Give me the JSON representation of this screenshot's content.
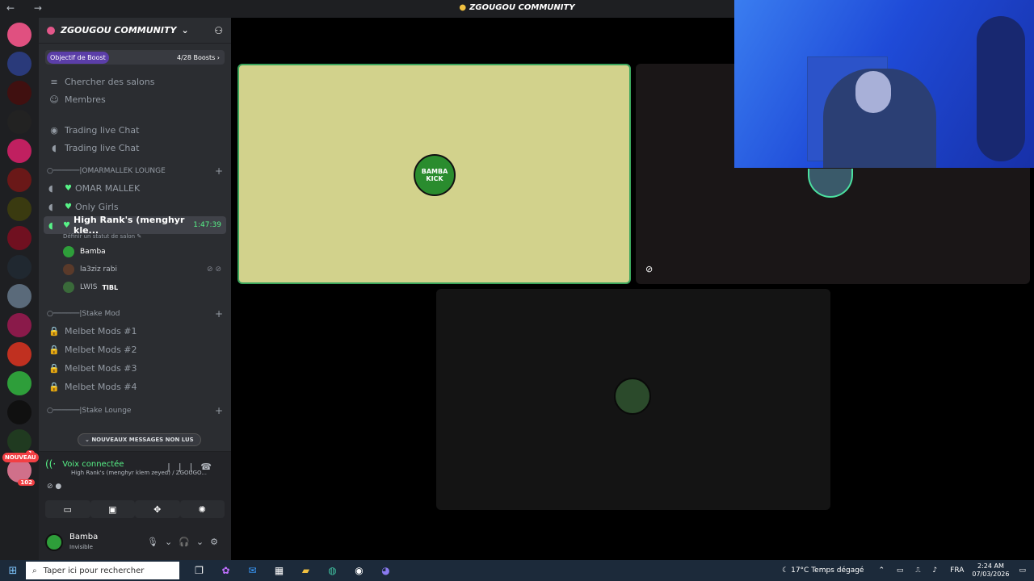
{
  "window": {
    "title": "ZGOUGOU COMMUNITY",
    "nav": "← →"
  },
  "server": {
    "name": "ZGOUGOU COMMUNITY",
    "boost_goal": "Objectif de Boost",
    "boost_count": "4/28 Boosts"
  },
  "menu": [
    {
      "label": "Chercher des salons",
      "icon": "≡"
    },
    {
      "label": "Membres",
      "icon": "☺"
    }
  ],
  "channels_top": [
    {
      "label": "Trading live Chat",
      "icon": "◉"
    },
    {
      "label": "Trading live Chat",
      "icon": "◖"
    }
  ],
  "categories": {
    "lounge": "○──────|OMARMALLEK LOUNGE",
    "stake_mod": "○──────|Stake Mod",
    "stake_lounge": "○──────|Stake Lounge"
  },
  "voice_channels": [
    {
      "label": "OMAR MALLEK"
    },
    {
      "label": "Only Girls"
    }
  ],
  "active_channel": {
    "label": "High Rank's (menghyr kle...",
    "time": "1:47:39",
    "status": "Définir un statut de salon"
  },
  "voice_users": [
    {
      "name": "Bamba",
      "color": "#2e9e3a"
    },
    {
      "name": "la3ziz rabi",
      "color": "#5a3a2a"
    },
    {
      "name": "LWIS",
      "color": "#3a6a3a",
      "tag": "TIBL"
    }
  ],
  "mod_channels": [
    "Melbet Mods #1",
    "Melbet Mods #2",
    "Melbet Mods #3",
    "Melbet Mods #4"
  ],
  "new_messages": "NOUVEAUX MESSAGES NON LUS",
  "guild_badges": {
    "nouveau": "NOUVEAU",
    "unread1": "1",
    "unread2": "102"
  },
  "voice_panel": {
    "status": "Voix connectée",
    "channel": "High Rank's (menghyr klem zeyed) / ZGOUGO..."
  },
  "user": {
    "name": "Bamba",
    "status": "Invisible"
  },
  "tiles": {
    "tile1_label": "BAMBA KICK"
  },
  "taskbar": {
    "search_placeholder": "Taper ici pour rechercher",
    "weather": "17°C  Temps dégagé",
    "lang": "FRA",
    "time": "2:24 AM",
    "date": "07/03/2026"
  }
}
